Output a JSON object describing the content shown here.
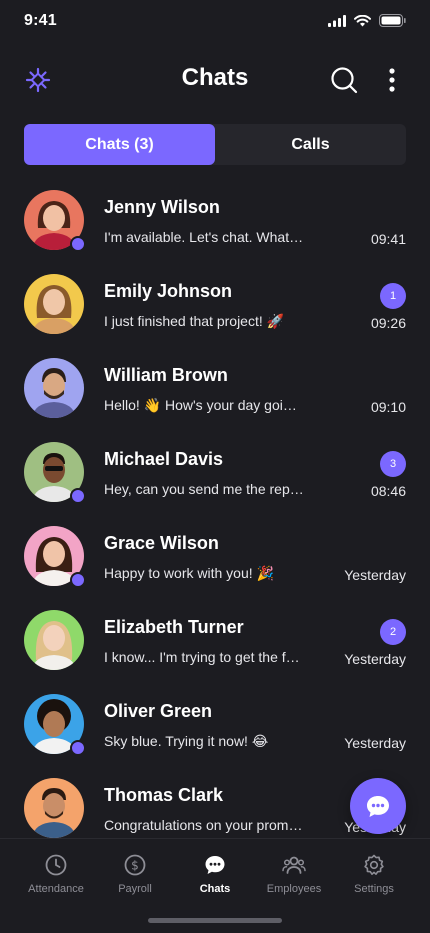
{
  "status_bar": {
    "time": "9:41"
  },
  "header": {
    "title": "Chats"
  },
  "tabs": [
    {
      "label": "Chats (3)",
      "active": true
    },
    {
      "label": "Calls",
      "active": false
    }
  ],
  "chats": [
    {
      "name": "Jenny Wilson",
      "preview": "I'm available. Let's chat. What time works for you?",
      "time": "09:41",
      "unread": "",
      "online": true,
      "avatar_bg": "#e8765f"
    },
    {
      "name": "Emily Johnson",
      "preview": "I just finished that project! 🚀",
      "time": "09:26",
      "unread": "1",
      "online": false,
      "avatar_bg": "#f2c94c"
    },
    {
      "name": "William Brown",
      "preview": "Hello! 👋 How's your day going?",
      "time": "09:10",
      "unread": "",
      "online": false,
      "avatar_bg": "#9fa4f0"
    },
    {
      "name": "Michael Davis",
      "preview": "Hey, can you send me the report?",
      "time": "08:46",
      "unread": "3",
      "online": true,
      "avatar_bg": "#9fbf82"
    },
    {
      "name": "Grace Wilson",
      "preview": "Happy to work with you! 🎉",
      "time": "Yesterday",
      "unread": "",
      "online": true,
      "avatar_bg": "#f2a4c6"
    },
    {
      "name": "Elizabeth Turner",
      "preview": "I know... I'm trying to get the funds.",
      "time": "Yesterday",
      "unread": "2",
      "online": false,
      "avatar_bg": "#8fd96a"
    },
    {
      "name": "Oliver Green",
      "preview": "Sky blue. Trying it now! 😂",
      "time": "Yesterday",
      "unread": "",
      "online": true,
      "avatar_bg": "#3ba3e8"
    },
    {
      "name": "Thomas Clark",
      "preview": "Congratulations on your promotion!",
      "time": "Yesterday",
      "unread": "",
      "online": false,
      "avatar_bg": "#f4a36b"
    }
  ],
  "nav": [
    {
      "label": "Attendance",
      "icon": "clock-icon",
      "active": false
    },
    {
      "label": "Payroll",
      "icon": "dollar-icon",
      "active": false
    },
    {
      "label": "Chats",
      "icon": "chat-bubble-icon",
      "active": true
    },
    {
      "label": "Employees",
      "icon": "users-icon",
      "active": false
    },
    {
      "label": "Settings",
      "icon": "gear-icon",
      "active": false
    }
  ],
  "colors": {
    "accent": "#7b68ff",
    "background": "#1c1c21",
    "surface": "#26262c"
  }
}
